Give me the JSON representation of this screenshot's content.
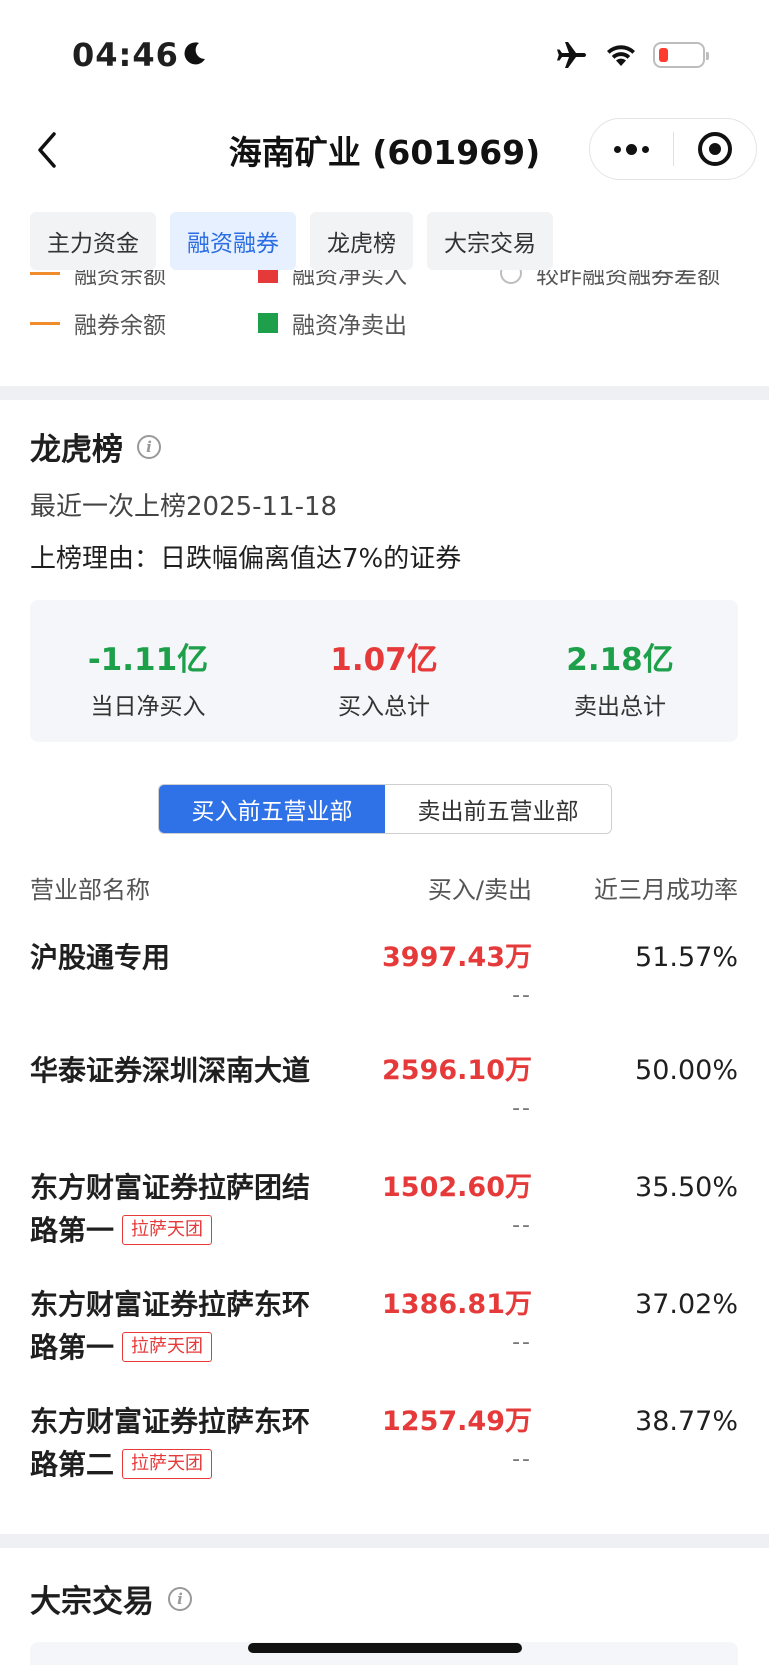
{
  "status_bar": {
    "time": "04:46"
  },
  "nav": {
    "title": "海南矿业 (601969)"
  },
  "tabs": [
    {
      "label": "主力资金",
      "active": false
    },
    {
      "label": "融资融券",
      "active": true
    },
    {
      "label": "龙虎榜",
      "active": false
    },
    {
      "label": "大宗交易",
      "active": false
    }
  ],
  "legend": {
    "partial_top": [
      "融资余额",
      "融资净买入",
      "较昨融资融券差额"
    ],
    "items": [
      {
        "label": "融券余额",
        "color": "#f08c2b",
        "shape": "line"
      },
      {
        "label": "融资净卖出",
        "color": "#1ea04b",
        "shape": "square"
      }
    ],
    "partial_colors": [
      "#f08c2b",
      "#e63a3a",
      "#bdbdbd"
    ]
  },
  "lhb": {
    "title": "龙虎榜",
    "recent": "最近一次上榜2025-11-18",
    "reason": "上榜理由：日跌幅偏离值达7%的证券",
    "summary": [
      {
        "value": "-1.11亿",
        "label": "当日净买入",
        "color": "#1ea04b"
      },
      {
        "value": "1.07亿",
        "label": "买入总计",
        "color": "#e63a3a"
      },
      {
        "value": "2.18亿",
        "label": "卖出总计",
        "color": "#1ea04b"
      }
    ],
    "toggle": {
      "buy": "买入前五营业部",
      "sell": "卖出前五营业部"
    },
    "table_head": {
      "name": "营业部名称",
      "amount": "买入/卖出",
      "rate": "近三月成功率"
    },
    "rows": [
      {
        "name": "沪股通专用",
        "tag": "",
        "buy": "3997.43万",
        "sell": "--",
        "rate": "51.57%"
      },
      {
        "name": "华泰证券深圳深南大道",
        "tag": "",
        "buy": "2596.10万",
        "sell": "--",
        "rate": "50.00%"
      },
      {
        "name": "东方财富证券拉萨团结路第一",
        "tag": "拉萨天团",
        "buy": "1502.60万",
        "sell": "--",
        "rate": "35.50%"
      },
      {
        "name": "东方财富证券拉萨东环路第一",
        "tag": "拉萨天团",
        "buy": "1386.81万",
        "sell": "--",
        "rate": "37.02%"
      },
      {
        "name": "东方财富证券拉萨东环路第二",
        "tag": "拉萨天团",
        "buy": "1257.49万",
        "sell": "--",
        "rate": "38.77%"
      }
    ]
  },
  "block_trade": {
    "title": "大宗交易"
  }
}
